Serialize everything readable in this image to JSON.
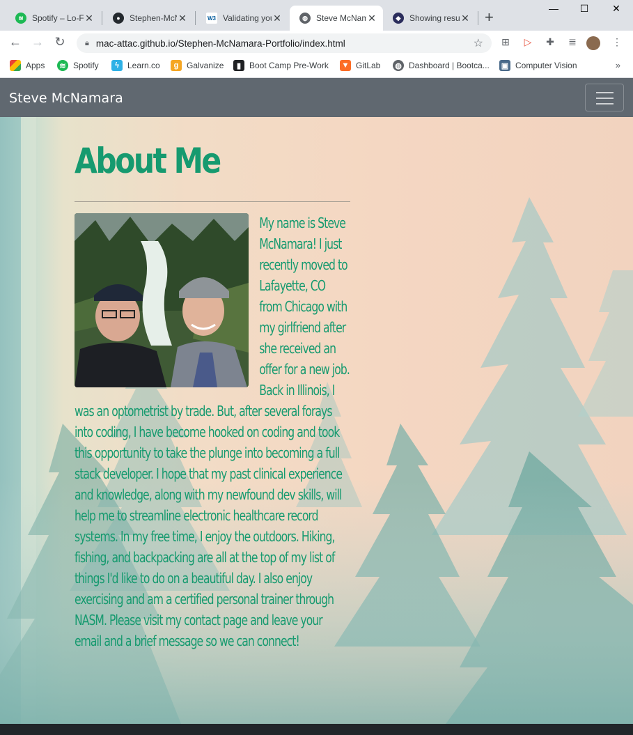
{
  "browser": {
    "tabs": [
      {
        "title": "Spotify – Lo-Fi",
        "icon": "spotify-icon",
        "active": false
      },
      {
        "title": "Stephen-McNamara",
        "icon": "github-icon",
        "active": false
      },
      {
        "title": "Validating your",
        "icon": "w3-icon",
        "active": false
      },
      {
        "title": "Steve McNamara",
        "icon": "globe-icon",
        "active": true
      },
      {
        "title": "Showing results",
        "icon": "dog-icon",
        "active": false
      }
    ],
    "url": "mac-attac.github.io/Stephen-McNamara-Portfolio/index.html",
    "bookmarks": [
      {
        "label": "Apps",
        "icon": "apps-grid-icon"
      },
      {
        "label": "Spotify",
        "icon": "spotify-icon"
      },
      {
        "label": "Learn.co",
        "icon": "learnco-icon"
      },
      {
        "label": "Galvanize",
        "icon": "galvanize-icon"
      },
      {
        "label": "Boot Camp Pre-Work",
        "icon": "book-icon"
      },
      {
        "label": "GitLab",
        "icon": "gitlab-icon"
      },
      {
        "label": "Dashboard | Bootca...",
        "icon": "globe-icon"
      },
      {
        "label": "Computer Vision",
        "icon": "image-icon"
      }
    ],
    "overflow_label": "»"
  },
  "site": {
    "brand": "Steve McNamara",
    "heading": "About Me",
    "photo_alt": "Steve with his father in front of a waterfall",
    "bio": "My name is Steve McNamara! I just recently moved to Lafayette, CO from Chicago with my girlfriend after she received an offer for a new job. Back in Illinois, I was an optometrist by trade. But, after several forays into coding, I have become hooked on coding and took this opportunity to take the plunge into becoming a full stack developer. I hope that my past clinical experience and knowledge, along with my newfound dev skills, will help me to streamline electronic healthcare record systems. In my free time, I enjoy the outdoors. Hiking, fishing, and backpacking are all at the top of my list of things I'd like to do on a beautiful day. I also enjoy exercising and am a certified personal trainer through NASM. Please visit my contact page and leave your email and a brief message so we can connect!"
  },
  "colors": {
    "accent": "#169a6f",
    "navbar": "#606870"
  }
}
